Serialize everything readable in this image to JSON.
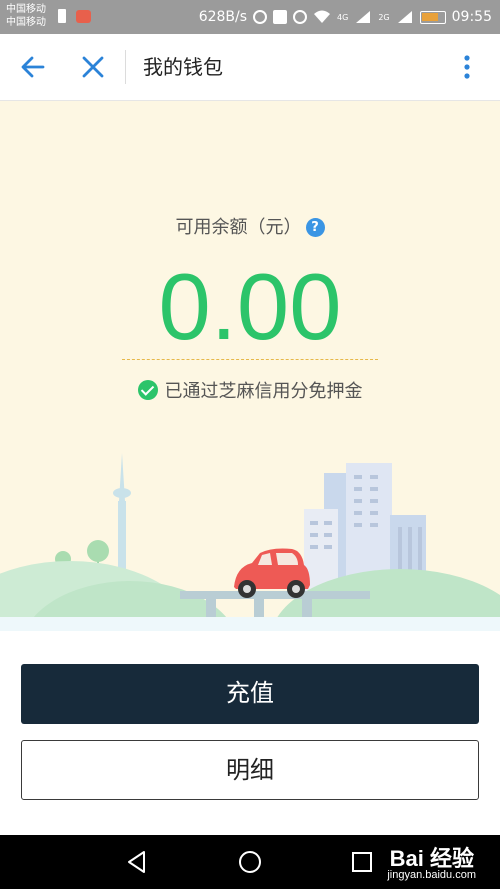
{
  "status_bar": {
    "carrier_line1": "中国移动",
    "carrier_line2": "中国移动",
    "net_speed": "628B/s",
    "network_4g": "4G",
    "network_2g": "2G",
    "time": "09:55"
  },
  "app_bar": {
    "title": "我的钱包",
    "back_icon": "arrow-left-icon",
    "close_icon": "close-icon",
    "more_icon": "more-vertical-icon",
    "accent_color": "#2b83d8"
  },
  "balance": {
    "label": "可用余额（元）",
    "help_glyph": "?",
    "amount": "0.00",
    "amount_color": "#2cc46a",
    "verified_text": "已通过芝麻信用分免押金"
  },
  "buttons": {
    "recharge_label": "充值",
    "detail_label": "明细",
    "recharge_bg": "#172a3a"
  },
  "watermark": {
    "brand": "Bai 经验",
    "url": "jingyan.baidu.com"
  }
}
